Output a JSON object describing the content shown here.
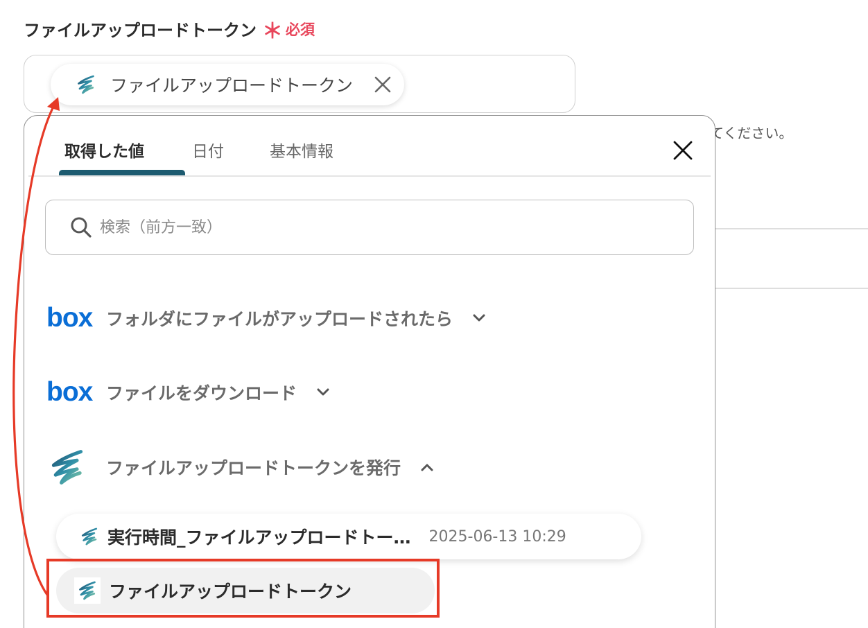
{
  "field": {
    "label": "ファイルアップロードトークン",
    "required_star": "＊",
    "required_text": "必須"
  },
  "chip": {
    "label": "ファイルアップロードトークン",
    "icon": "yoom-logo-icon",
    "close_icon": "close-icon"
  },
  "background": {
    "help_text_fragment": "てください。"
  },
  "popup": {
    "tabs": [
      {
        "label": "取得した値",
        "active": true
      },
      {
        "label": "日付",
        "active": false
      },
      {
        "label": "基本情報",
        "active": false
      }
    ],
    "close_icon": "close-icon",
    "search": {
      "placeholder": "検索（前方一致）",
      "icon": "search-icon"
    },
    "groups": [
      {
        "logo": "box",
        "label": "フォルダにファイルがアップロードされたら",
        "expanded": false
      },
      {
        "logo": "box",
        "label": "ファイルをダウンロード",
        "expanded": false
      },
      {
        "icon": "yoom-logo-icon",
        "label": "ファイルアップロードトークンを発行",
        "expanded": true
      }
    ],
    "results": [
      {
        "label": "実行時間_ファイルアップロードトー…",
        "value": "2025-06-13 10:29"
      },
      {
        "label": "ファイルアップロードトークン",
        "value": ""
      }
    ]
  },
  "annotation": {
    "color": "#e63a27"
  }
}
